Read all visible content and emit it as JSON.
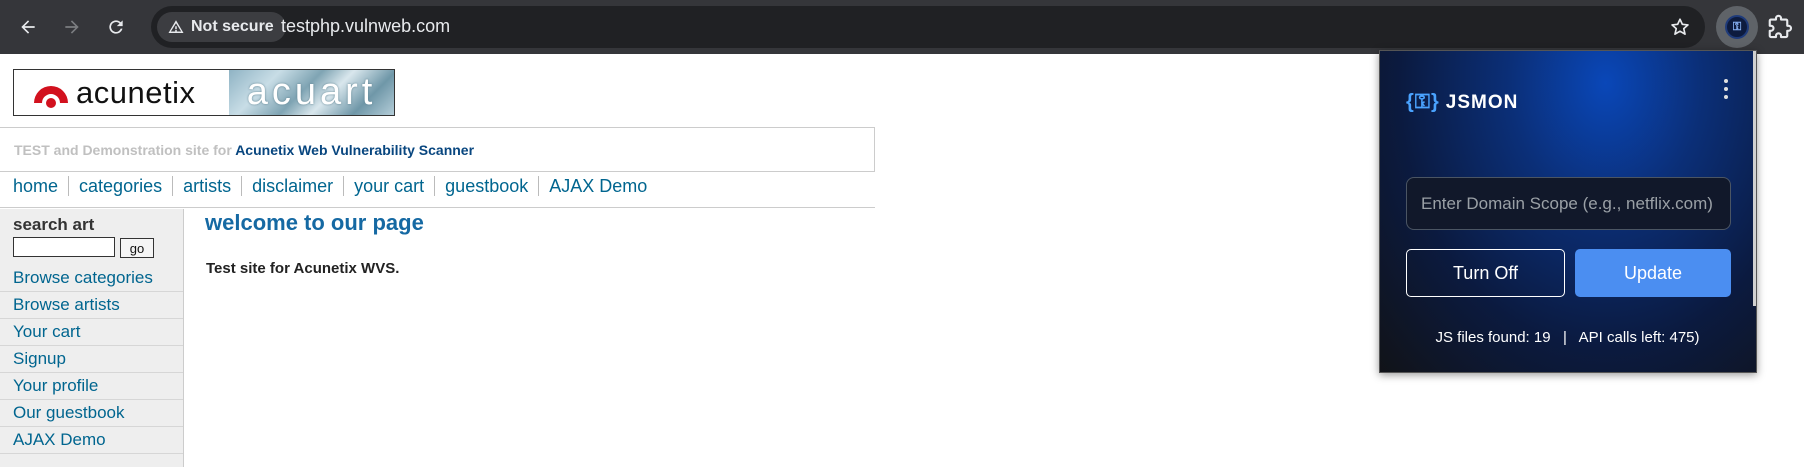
{
  "browser": {
    "security_label": "Not secure",
    "url": "testphp.vulnweb.com"
  },
  "site": {
    "logo_text": "acunetix",
    "logo_banner": "acuart",
    "tagline_prefix": "TEST and Demonstration site for",
    "tagline_link": "Acunetix Web Vulnerability Scanner",
    "top_nav": [
      "home",
      "categories",
      "artists",
      "disclaimer",
      "your cart",
      "guestbook",
      "AJAX Demo"
    ],
    "search_title": "search art",
    "search_value": "",
    "go_label": "go",
    "side_nav": [
      "Browse categories",
      "Browse artists",
      "Your cart",
      "Signup",
      "Your profile",
      "Our guestbook",
      "AJAX Demo"
    ],
    "main_title": "welcome to our page",
    "main_text": "Test site for Acunetix WVS."
  },
  "extension": {
    "name": "JSMON",
    "domain_placeholder": "Enter Domain Scope (e.g., netflix.com)",
    "domain_value": "",
    "turn_off_label": "Turn Off",
    "update_label": "Update",
    "status_text": "JS files found: 19   |   API calls left: 475)",
    "accent_color": "#4b8ef1"
  },
  "icons": [
    "back-arrow-icon",
    "forward-arrow-icon",
    "reload-icon",
    "warning-icon",
    "star-icon",
    "jsmon-extension-icon",
    "puzzle-icon",
    "kebab-menu-icon",
    "key-icon"
  ]
}
